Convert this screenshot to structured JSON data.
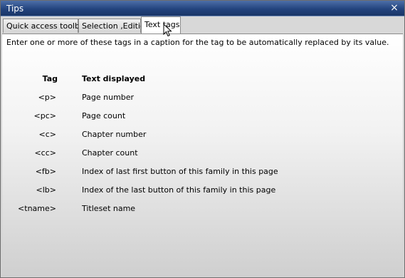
{
  "window": {
    "title": "Tips",
    "close_label": "×"
  },
  "tabs": [
    {
      "label": "Quick access toolbar",
      "active": false
    },
    {
      "label": "Selection ,Edition",
      "active": false
    },
    {
      "label": "Text tags",
      "active": true
    }
  ],
  "content": {
    "intro": "Enter one or more of these tags in a caption for the tag to be automatically replaced by its value.",
    "columns": {
      "tag": "Tag",
      "text": "Text displayed"
    },
    "rows": [
      {
        "tag": "<p>",
        "text": "Page number"
      },
      {
        "tag": "<pc>",
        "text": "Page count"
      },
      {
        "tag": "<c>",
        "text": "Chapter number"
      },
      {
        "tag": "<cc>",
        "text": "Chapter count"
      },
      {
        "tag": "<fb>",
        "text": "Index of last first button of this family in this page"
      },
      {
        "tag": "<lb>",
        "text": "Index of the last button of this family in this page"
      },
      {
        "tag": "<tname>",
        "text": "Titleset name"
      }
    ]
  },
  "colors": {
    "titlebar": "#23447e",
    "content_top": "#ffffff",
    "content_bottom": "#cfcfcf"
  }
}
